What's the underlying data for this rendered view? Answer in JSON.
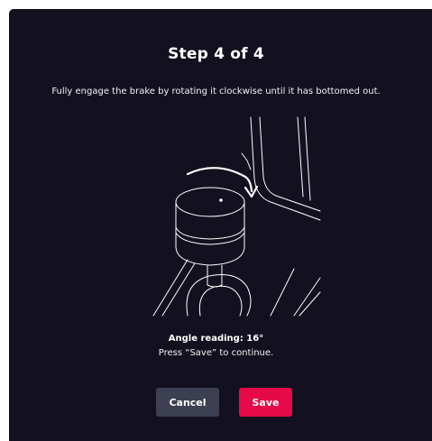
{
  "dialog": {
    "title": "Step 4 of 4",
    "instruction": "Fully engage the brake by rotating it clockwise until it has bottomed out.",
    "illustration_icon": "brake-knob-rotate-clockwise-illustration",
    "angle_reading": "Angle reading: 16°",
    "continue_hint": "Press “Save” to continue.",
    "cancel_label": "Cancel",
    "save_label": "Save"
  },
  "colors": {
    "background": "#13111f",
    "cancel_button": "#3d3f52",
    "save_button": "#e5094a",
    "text": "#ffffff"
  }
}
